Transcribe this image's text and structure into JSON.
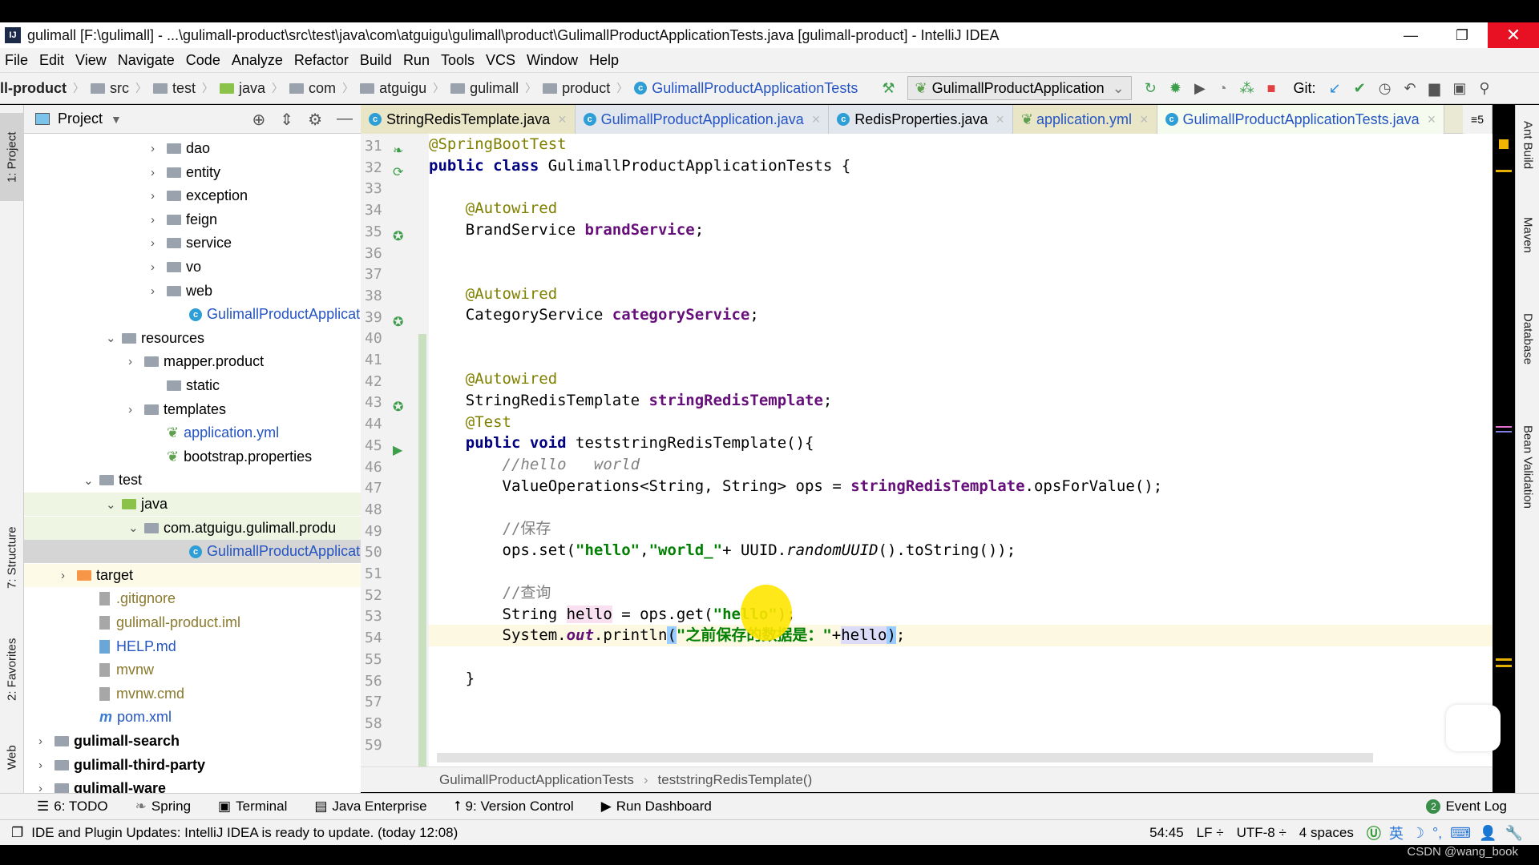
{
  "window": {
    "title": "gulimall [F:\\gulimall] - ...\\gulimall-product\\src\\test\\java\\com\\atguigu\\gulimall\\product\\GulimallProductApplicationTests.java [gulimall-product] - IntelliJ IDEA",
    "logo": "IJ",
    "minimize": "—",
    "restore": "❐",
    "close": "✕"
  },
  "menu": [
    "File",
    "Edit",
    "View",
    "Navigate",
    "Code",
    "Analyze",
    "Refactor",
    "Build",
    "Run",
    "Tools",
    "VCS",
    "Window",
    "Help"
  ],
  "navbar": {
    "crumbs": [
      "ll-product",
      "src",
      "test",
      "java",
      "com",
      "atguigu",
      "gulimall",
      "product",
      "GulimallProductApplicationTests"
    ],
    "run_config": "GulimallProductApplication",
    "git_label": "Git:"
  },
  "project_panel": {
    "title": "Project",
    "tree": [
      {
        "label": "dao",
        "depth": 6,
        "arrow": "›",
        "icon": "folder"
      },
      {
        "label": "entity",
        "depth": 6,
        "arrow": "›",
        "icon": "folder"
      },
      {
        "label": "exception",
        "depth": 6,
        "arrow": "›",
        "icon": "folder"
      },
      {
        "label": "feign",
        "depth": 6,
        "arrow": "›",
        "icon": "folder"
      },
      {
        "label": "service",
        "depth": 6,
        "arrow": "›",
        "icon": "folder"
      },
      {
        "label": "vo",
        "depth": 6,
        "arrow": "›",
        "icon": "folder"
      },
      {
        "label": "web",
        "depth": 6,
        "arrow": "›",
        "icon": "folder"
      },
      {
        "label": "GulimallProductApplicat",
        "depth": 7,
        "arrow": "",
        "icon": "class"
      },
      {
        "label": "resources",
        "depth": 4,
        "arrow": "⌄",
        "icon": "folder"
      },
      {
        "label": "mapper.product",
        "depth": 5,
        "arrow": "›",
        "icon": "folder"
      },
      {
        "label": "static",
        "depth": 6,
        "arrow": "",
        "icon": "folder"
      },
      {
        "label": "templates",
        "depth": 5,
        "arrow": "›",
        "icon": "folder"
      },
      {
        "label": "application.yml",
        "depth": 6,
        "arrow": "",
        "icon": "spring"
      },
      {
        "label": "bootstrap.properties",
        "depth": 6,
        "arrow": "",
        "icon": "spring"
      },
      {
        "label": "test",
        "depth": 3,
        "arrow": "⌄",
        "icon": "folder"
      },
      {
        "label": "java",
        "depth": 4,
        "arrow": "⌄",
        "icon": "folder-green"
      },
      {
        "label": "com.atguigu.gulimall.produ",
        "depth": 5,
        "arrow": "⌄",
        "icon": "folder"
      },
      {
        "label": "GulimallProductApplicat",
        "depth": 7,
        "arrow": "",
        "icon": "class"
      },
      {
        "label": "target",
        "depth": 2,
        "arrow": "›",
        "icon": "folder-orange"
      },
      {
        "label": ".gitignore",
        "depth": 3,
        "arrow": "",
        "icon": "file"
      },
      {
        "label": "gulimall-product.iml",
        "depth": 3,
        "arrow": "",
        "icon": "file"
      },
      {
        "label": "HELP.md",
        "depth": 3,
        "arrow": "",
        "icon": "md"
      },
      {
        "label": "mvnw",
        "depth": 3,
        "arrow": "",
        "icon": "file"
      },
      {
        "label": "mvnw.cmd",
        "depth": 3,
        "arrow": "",
        "icon": "file"
      },
      {
        "label": "pom.xml",
        "depth": 3,
        "arrow": "",
        "icon": "maven"
      },
      {
        "label": "gulimall-search",
        "depth": 1,
        "arrow": "›",
        "icon": "module"
      },
      {
        "label": "gulimall-third-party",
        "depth": 1,
        "arrow": "›",
        "icon": "module"
      },
      {
        "label": "gulimall-ware",
        "depth": 1,
        "arrow": "›",
        "icon": "module"
      }
    ]
  },
  "left_tool_tabs": [
    "1: Project",
    "7: Structure",
    "2: Favorites",
    "Web"
  ],
  "right_tool_tabs": [
    "Ant Build",
    "Maven",
    "Database",
    "Bean Validation"
  ],
  "editor_tabs": [
    {
      "label": "StringRedisTemplate.java",
      "active": false
    },
    {
      "label": "GulimallProductApplication.java",
      "active": false
    },
    {
      "label": "RedisProperties.java",
      "active": false
    },
    {
      "label": "application.yml",
      "active": false
    },
    {
      "label": "GulimallProductApplicationTests.java",
      "active": true
    }
  ],
  "tab_overflow": "≡5",
  "code": {
    "line_numbers": [
      "31",
      "32",
      "33",
      "34",
      "35",
      "36",
      "37",
      "38",
      "39",
      "40",
      "41",
      "42",
      "43",
      "44",
      "45",
      "46",
      "47",
      "48",
      "49",
      "50",
      "51",
      "52",
      "53",
      "54",
      "55",
      "56",
      "57",
      "58",
      "59"
    ],
    "l31": "@SpringBootTest",
    "l32a": "public class ",
    "l32b": "GulimallProductApplicationTests {",
    "l34": "    @Autowired",
    "l35a": "    BrandService ",
    "l35b": "brandService",
    "l35c": ";",
    "l38": "    @Autowired",
    "l39a": "    CategoryService ",
    "l39b": "categoryService",
    "l39c": ";",
    "l42": "    @Autowired",
    "l43a": "    StringRedisTemplate ",
    "l43b": "stringRedisTemplate",
    "l43c": ";",
    "l44": "    @Test",
    "l45a": "    public void ",
    "l45b": "teststringRedisTemplate(){",
    "l46": "        //hello   world",
    "l47a": "        ValueOperations<String, String> ops = ",
    "l47b": "stringRedisTemplate",
    "l47c": ".opsForValue();",
    "l49": "        //保存",
    "l50a": "        ops.set(",
    "l50b": "\"hello\"",
    "l50c": ",",
    "l50d": "\"world_\"",
    "l50e": "+ UUID.",
    "l50f": "randomUUID",
    "l50g": "().toString());",
    "l52": "        //查询",
    "l53a": "        String ",
    "l53b": "hello",
    "l53c": " = ops.get(",
    "l53d": "\"hello\"",
    "l53e": ");",
    "l54a": "        System.",
    "l54b": "out",
    "l54c": ".println",
    "l54d": "(",
    "l54e": "\"之前保存的数据是：\"",
    "l54f": "+",
    "l54g": "hello",
    "l54h": ")",
    "l54i": ";",
    "l56": "    }"
  },
  "editor_breadcrumb": [
    "GulimallProductApplicationTests",
    "teststringRedisTemplate()"
  ],
  "tool_windows": [
    "6: TODO",
    "Spring",
    "Terminal",
    "Java Enterprise",
    "9: Version Control",
    "Run Dashboard"
  ],
  "event_log": {
    "label": "Event Log",
    "count": "2"
  },
  "status": {
    "message": "IDE and Plugin Updates: IntelliJ IDEA is ready to update. (today 12:08)",
    "position": "54:45",
    "line_sep": "LF ÷",
    "encoding": "UTF-8 ÷",
    "indent": "4 spaces",
    "ime": [
      "英",
      "☽",
      "°,",
      "⌨",
      "👤",
      "🔧"
    ]
  },
  "watermark": "CSDN @wang_book",
  "colors": {
    "accent": "#2555c2",
    "close_red": "#e81123",
    "keyword": "#000080",
    "string": "#007f00",
    "field": "#660e7a"
  }
}
